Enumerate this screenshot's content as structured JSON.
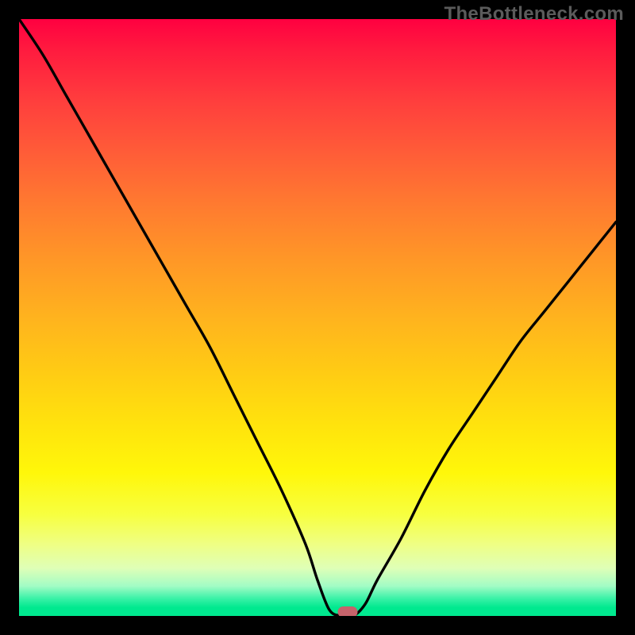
{
  "watermark": "TheBottleneck.com",
  "colors": {
    "frame": "#000000",
    "watermark_text": "#5b5b5b",
    "curve": "#000000",
    "marker": "#c6636b",
    "gradient_top": "#ff0040",
    "gradient_bottom": "#00e98f"
  },
  "chart_data": {
    "type": "line",
    "title": "",
    "xlabel": "",
    "ylabel": "",
    "xlim": [
      0,
      100
    ],
    "ylim": [
      0,
      100
    ],
    "grid": false,
    "series": [
      {
        "name": "bottleneck-curve",
        "x": [
          0,
          4,
          8,
          12,
          16,
          20,
          24,
          28,
          32,
          36,
          40,
          44,
          48,
          50,
          52,
          54,
          56,
          58,
          60,
          64,
          68,
          72,
          76,
          80,
          84,
          88,
          92,
          96,
          100
        ],
        "values": [
          100,
          94,
          87,
          80,
          73,
          66,
          59,
          52,
          45,
          37,
          29,
          21,
          12,
          6,
          1,
          0,
          0,
          2,
          6,
          13,
          21,
          28,
          34,
          40,
          46,
          51,
          56,
          61,
          66
        ]
      }
    ],
    "marker": {
      "x": 55,
      "y": 0.6
    },
    "background_gradient": {
      "orientation": "vertical",
      "stops": [
        {
          "pos": 0.0,
          "color": "#ff0040"
        },
        {
          "pos": 0.14,
          "color": "#ff3f3d"
        },
        {
          "pos": 0.31,
          "color": "#ff7a30"
        },
        {
          "pos": 0.5,
          "color": "#ffb31e"
        },
        {
          "pos": 0.68,
          "color": "#ffe30d"
        },
        {
          "pos": 0.83,
          "color": "#f7ff40"
        },
        {
          "pos": 0.92,
          "color": "#dfffb7"
        },
        {
          "pos": 0.97,
          "color": "#3df2a8"
        },
        {
          "pos": 1.0,
          "color": "#00e98f"
        }
      ]
    }
  }
}
